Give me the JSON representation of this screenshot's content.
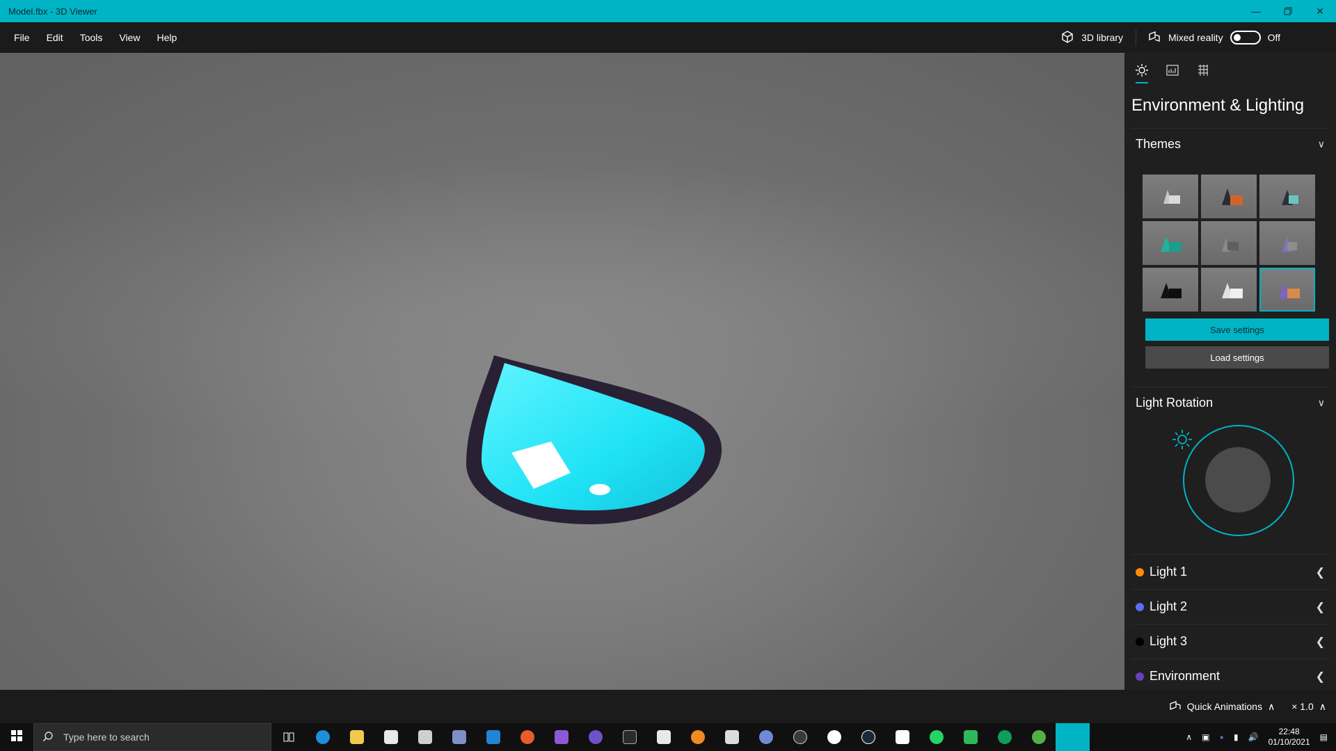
{
  "window": {
    "title": "Model.fbx - 3D Viewer",
    "controls": [
      "minimize-icon",
      "restore-icon",
      "close-icon"
    ]
  },
  "menu": {
    "items": [
      "File",
      "Edit",
      "Tools",
      "View",
      "Help"
    ],
    "library_label": "3D library",
    "mixed_reality_label": "Mixed reality",
    "mixed_reality_state": "Off"
  },
  "panel": {
    "tabs": [
      "sun-icon",
      "stats-icon",
      "grid-icon"
    ],
    "title": "Environment & Lighting",
    "themes_label": "Themes",
    "save_label": "Save settings",
    "load_label": "Load settings",
    "rotation_label": "Light Rotation",
    "lights": [
      {
        "label": "Light 1",
        "color": "#ff8c00"
      },
      {
        "label": "Light 2",
        "color": "#5c6cf5"
      },
      {
        "label": "Light 3",
        "color": "#000000"
      },
      {
        "label": "Environment",
        "color": "#6a3fbf"
      }
    ],
    "accent": "#00b4c5"
  },
  "bottombar": {
    "quick_animations": "Quick Animations",
    "speed": "× 1.0"
  },
  "taskbar": {
    "search_placeholder": "Type here to search",
    "time": "22:48",
    "date": "01/10/2021"
  }
}
